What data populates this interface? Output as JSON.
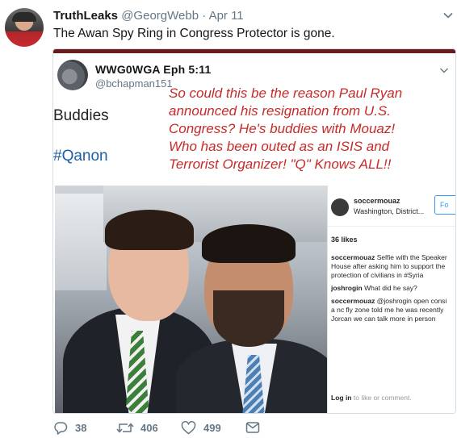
{
  "author": {
    "name": "TruthLeaks",
    "handle": "@GeorgWebb",
    "separator": "·",
    "date": "Apr 11"
  },
  "tweet": {
    "text": "The Awan Spy Ring in Congress Protector is gone."
  },
  "embedded": {
    "name": "WWG0WGA Eph 5:11",
    "handle": "@bchapman151",
    "left_word_1": "Buddies",
    "left_word_2": "#Qanon",
    "overlay_lines": [
      "So could this be the reason Paul Ryan",
      "announced his resignation from U.S.",
      "Congress?  He's buddies with Mouaz!",
      "Who has been outed as an ISIS and",
      "Terrorist Organizer!  \"Q\" Knows ALL!!"
    ],
    "instagram": {
      "username": "soccermouaz",
      "location": "Washington, District...",
      "follow": "Fo",
      "likes": "36 likes",
      "comments": [
        {
          "user": "soccermouaz",
          "text": "Selfie with the Speaker"
        },
        {
          "user": "",
          "text": "House after asking him to support the"
        },
        {
          "user": "",
          "text": "protection of civilians in #Syria"
        },
        {
          "user": "joshrogin",
          "text": "What did he say?"
        },
        {
          "user": "soccermouaz",
          "text": "@joshrogin open consi"
        },
        {
          "user": "",
          "text": "a nc fly zone told me he was recently"
        },
        {
          "user": "",
          "text": "Jorcan we can talk more in person"
        }
      ],
      "login_prefix": "Log in",
      "login_suffix": "to like or comment."
    }
  },
  "actions": {
    "replies": "38",
    "retweets": "406",
    "likes": "499"
  },
  "icons": {
    "caret": "chevron-down-icon",
    "reply": "reply-icon",
    "retweet": "retweet-icon",
    "like": "heart-icon",
    "dm": "envelope-icon"
  },
  "colors": {
    "overlay_red": "#c62a2a",
    "hashtag_blue": "#1b5fa5",
    "meta_gray": "#657786"
  }
}
